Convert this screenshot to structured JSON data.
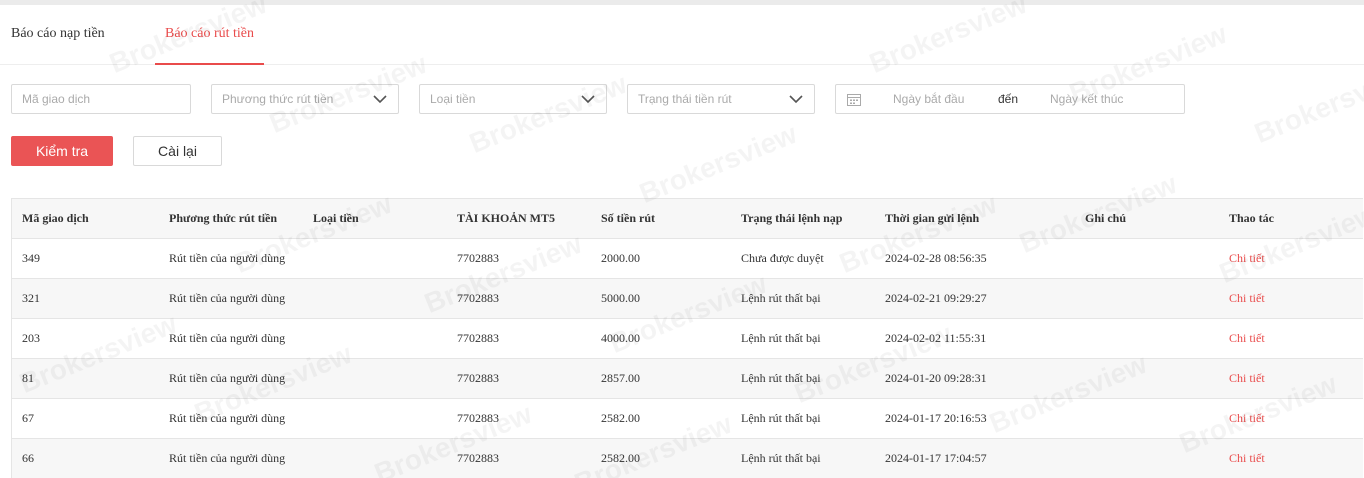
{
  "tabs": [
    {
      "label": "Báo cáo nạp tiền",
      "active": false
    },
    {
      "label": "Báo cáo rút tiền",
      "active": true
    }
  ],
  "filters": {
    "transaction_id": {
      "placeholder": "Mã giao dịch",
      "value": ""
    },
    "withdraw_method": {
      "placeholder": "Phương thức rút tiền"
    },
    "currency_type": {
      "placeholder": "Loại tiền"
    },
    "withdraw_status": {
      "placeholder": "Trạng thái tiền rút"
    },
    "date_range": {
      "start_placeholder": "Ngày bắt đầu",
      "separator": "đến",
      "end_placeholder": "Ngày kết thúc"
    }
  },
  "buttons": {
    "check": "Kiểm tra",
    "reset": "Cài lại"
  },
  "table": {
    "headers": [
      "Mã giao dịch",
      "Phương thức rút tiền",
      "Loại tiền",
      "TÀI KHOẢN MT5",
      "Số tiền rút",
      "Trạng thái lệnh nạp",
      "Thời gian gửi lệnh",
      "Ghi chú",
      "Thao tác"
    ],
    "rows": [
      {
        "id": "349",
        "method": "Rút tiền của người dùng",
        "currency": "",
        "account": "7702883",
        "amount": "2000.00",
        "status": "Chưa được duyệt",
        "time": "2024-02-28 08:56:35",
        "note": "",
        "action": "Chi tiết"
      },
      {
        "id": "321",
        "method": "Rút tiền của người dùng",
        "currency": "",
        "account": "7702883",
        "amount": "5000.00",
        "status": "Lệnh rút thất bại",
        "time": "2024-02-21 09:29:27",
        "note": "",
        "action": "Chi tiết"
      },
      {
        "id": "203",
        "method": "Rút tiền của người dùng",
        "currency": "",
        "account": "7702883",
        "amount": "4000.00",
        "status": "Lệnh rút thất bại",
        "time": "2024-02-02 11:55:31",
        "note": "",
        "action": "Chi tiết"
      },
      {
        "id": "81",
        "method": "Rút tiền của người dùng",
        "currency": "",
        "account": "7702883",
        "amount": "2857.00",
        "status": "Lệnh rút thất bại",
        "time": "2024-01-20 09:28:31",
        "note": "",
        "action": "Chi tiết"
      },
      {
        "id": "67",
        "method": "Rút tiền của người dùng",
        "currency": "",
        "account": "7702883",
        "amount": "2582.00",
        "status": "Lệnh rút thất bại",
        "time": "2024-01-17 20:16:53",
        "note": "",
        "action": "Chi tiết"
      },
      {
        "id": "66",
        "method": "Rút tiền của người dùng",
        "currency": "",
        "account": "7702883",
        "amount": "2582.00",
        "status": "Lệnh rút thất bại",
        "time": "2024-01-17 17:04:57",
        "note": "",
        "action": "Chi tiết"
      }
    ]
  },
  "watermark": "Brokersview",
  "colors": {
    "accent": "#e94b4b",
    "button_primary": "#ea5455",
    "header_bg": "#f7f7f7",
    "border": "#e5e5e5"
  },
  "icons": {
    "select_arrow": "chevron-down-icon",
    "date": "calendar-icon"
  }
}
